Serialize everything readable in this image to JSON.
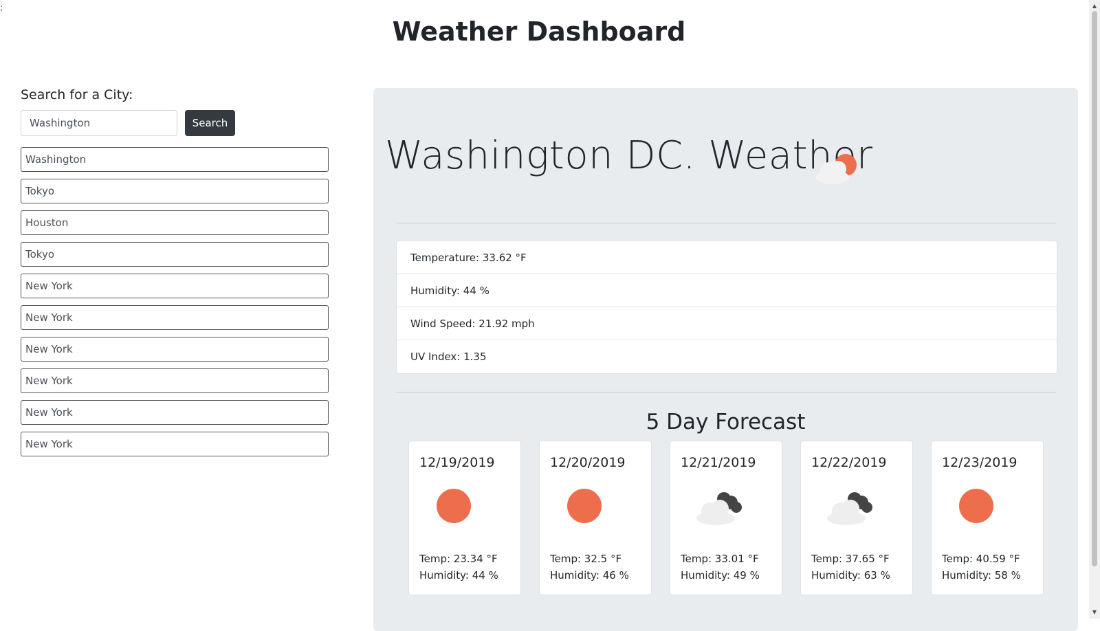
{
  "page": {
    "stray_text": ";",
    "title": "Weather Dashboard"
  },
  "search": {
    "label": "Search for a City:",
    "value": "Washington",
    "button_label": "Search"
  },
  "history": [
    "Washington",
    "Tokyo",
    "Houston",
    "Tokyo",
    "New York",
    "New York",
    "New York",
    "New York",
    "New York",
    "New York"
  ],
  "current": {
    "title": "Washington DC. Weather",
    "icon": "partly-cloudy-icon",
    "stats": [
      "Temperature: 33.62 °F",
      "Humidity: 44 %",
      "Wind Speed: 21.92 mph",
      "UV Index: 1.35"
    ]
  },
  "forecast": {
    "title": "5 Day Forecast",
    "days": [
      {
        "date": "12/19/2019",
        "icon": "sun-icon",
        "temp": "Temp: 23.34 °F",
        "humidity": "Humidity: 44 %"
      },
      {
        "date": "12/20/2019",
        "icon": "sun-icon",
        "temp": "Temp: 32.5 °F",
        "humidity": "Humidity: 46 %"
      },
      {
        "date": "12/21/2019",
        "icon": "cloudy-icon",
        "temp": "Temp: 33.01 °F",
        "humidity": "Humidity: 49 %"
      },
      {
        "date": "12/22/2019",
        "icon": "cloudy-icon",
        "temp": "Temp: 37.65 °F",
        "humidity": "Humidity: 63 %"
      },
      {
        "date": "12/23/2019",
        "icon": "sun-icon",
        "temp": "Temp: 40.59 °F",
        "humidity": "Humidity: 58 %"
      }
    ]
  },
  "colors": {
    "sun": "#ec6e4c",
    "cloud_light": "#eeeeee",
    "cloud_dark": "#444444",
    "panel": "#e9ecef",
    "button": "#343a40"
  }
}
